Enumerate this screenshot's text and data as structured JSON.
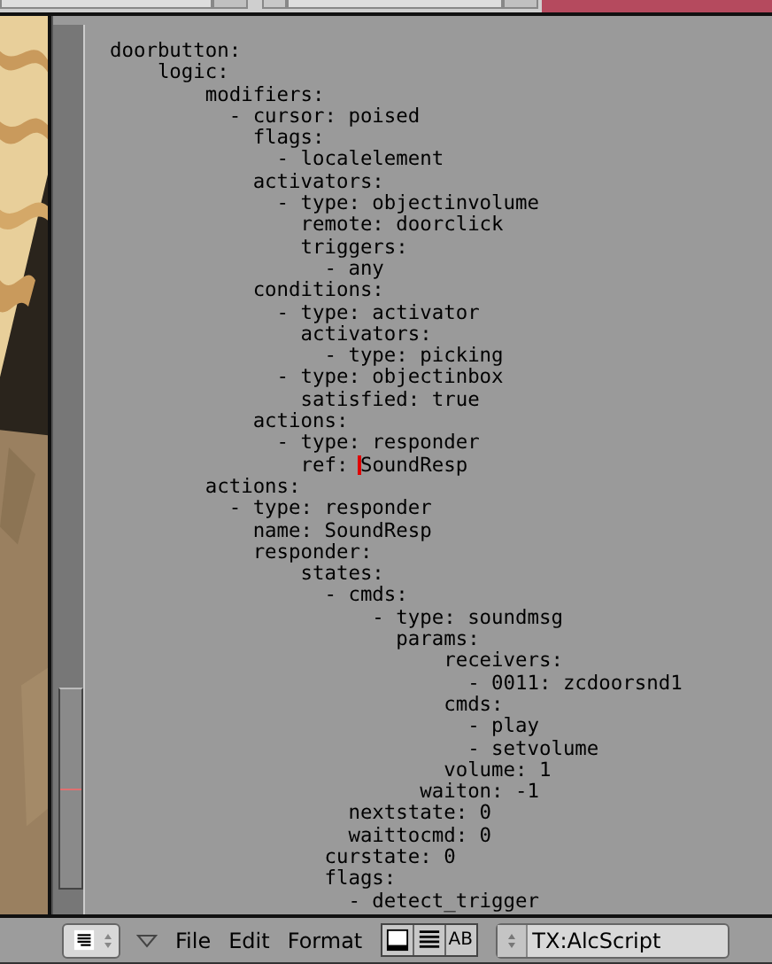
{
  "editor": {
    "lines": [
      {
        "text": "doorbutton:"
      },
      {
        "text": "    logic:"
      },
      {
        "text": "        modifiers:"
      },
      {
        "text": "          - cursor: poised"
      },
      {
        "text": "            flags:"
      },
      {
        "text": "              - localelement"
      },
      {
        "text": "            activators:"
      },
      {
        "text": "              - type: objectinvolume"
      },
      {
        "text": "                remote: doorclick"
      },
      {
        "text": "                triggers:"
      },
      {
        "text": "                  - any"
      },
      {
        "text": "            conditions:"
      },
      {
        "text": "              - type: activator"
      },
      {
        "text": "                activators:"
      },
      {
        "text": "                  - type: picking"
      },
      {
        "text": "              - type: objectinbox"
      },
      {
        "text": "                satisfied: true"
      },
      {
        "text": "            actions:"
      },
      {
        "text": "              - type: responder"
      },
      {
        "text": "                ref: ",
        "text_after": "SoundResp",
        "cursor": true
      },
      {
        "text": "        actions:"
      },
      {
        "text": "          - type: responder"
      },
      {
        "text": "            name: SoundResp"
      },
      {
        "text": "            responder:"
      },
      {
        "text": "                states:"
      },
      {
        "text": "                  - cmds:"
      },
      {
        "text": "                      - type: soundmsg"
      },
      {
        "text": "                        params:"
      },
      {
        "text": "                            receivers:"
      },
      {
        "text": "                              - 0011: zcdoorsnd1"
      },
      {
        "text": "                            cmds:"
      },
      {
        "text": "                              - play"
      },
      {
        "text": "                              - setvolume"
      },
      {
        "text": "                            volume: 1"
      },
      {
        "text": "                          waiton: -1"
      },
      {
        "text": "                    nextstate: 0"
      },
      {
        "text": "                    waittocmd: 0"
      },
      {
        "text": "                  curstate: 0"
      },
      {
        "text": "                  flags:"
      },
      {
        "text": "                    - detect_trigger"
      }
    ]
  },
  "header": {
    "menus": [
      {
        "label": "File"
      },
      {
        "label": "Edit"
      },
      {
        "label": "Format"
      }
    ],
    "toggles": [
      {
        "kind": "fullscreen",
        "on": false
      },
      {
        "kind": "lines",
        "on": false
      },
      {
        "kind": "wrap",
        "label": "AB",
        "on": false
      }
    ],
    "text_block": "TX:AlcScript"
  }
}
